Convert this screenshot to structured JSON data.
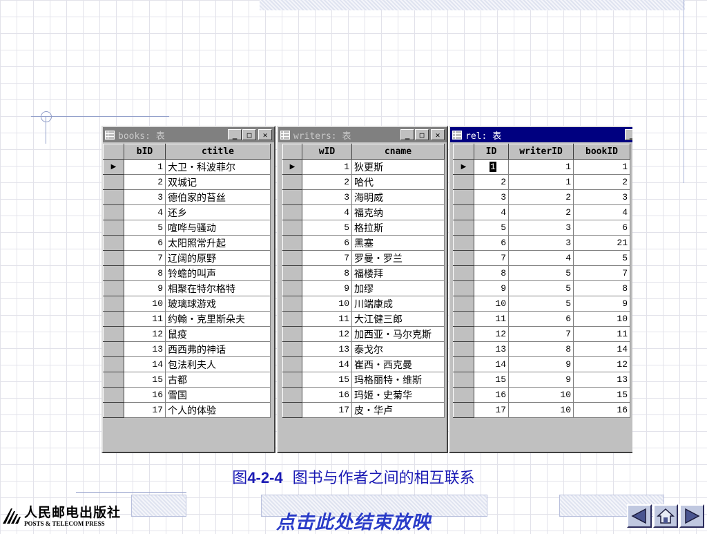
{
  "books_window": {
    "title": "books: 表",
    "columns": [
      "bID",
      "ctitle"
    ],
    "rows": [
      [
        "1",
        "大卫・科波菲尔"
      ],
      [
        "2",
        "双城记"
      ],
      [
        "3",
        "德伯家的苔丝"
      ],
      [
        "4",
        "还乡"
      ],
      [
        "5",
        "喧哗与骚动"
      ],
      [
        "6",
        "太阳照常升起"
      ],
      [
        "7",
        "辽阔的原野"
      ],
      [
        "8",
        "铃蟾的叫声"
      ],
      [
        "9",
        "相聚在特尔格特"
      ],
      [
        "10",
        "玻璃球游戏"
      ],
      [
        "11",
        "约翰・克里斯朵夫"
      ],
      [
        "12",
        "鼠疫"
      ],
      [
        "13",
        "西西弗的神话"
      ],
      [
        "14",
        "包法利夫人"
      ],
      [
        "15",
        "古都"
      ],
      [
        "16",
        "雪国"
      ],
      [
        "17",
        "个人的体验"
      ]
    ]
  },
  "writers_window": {
    "title": "writers: 表",
    "columns": [
      "wID",
      "cname"
    ],
    "rows": [
      [
        "1",
        "狄更斯"
      ],
      [
        "2",
        "哈代"
      ],
      [
        "3",
        "海明威"
      ],
      [
        "4",
        "福克纳"
      ],
      [
        "5",
        "格拉斯"
      ],
      [
        "6",
        "黑塞"
      ],
      [
        "7",
        "罗曼・罗兰"
      ],
      [
        "8",
        "福楼拜"
      ],
      [
        "9",
        "加缪"
      ],
      [
        "10",
        "川端康成"
      ],
      [
        "11",
        "大江健三郎"
      ],
      [
        "12",
        "加西亚・马尔克斯"
      ],
      [
        "13",
        "泰戈尔"
      ],
      [
        "14",
        "崔西・西克曼"
      ],
      [
        "15",
        "玛格丽特・维斯"
      ],
      [
        "16",
        "玛姬・史菊华"
      ],
      [
        "17",
        "皮・华卢"
      ]
    ]
  },
  "rel_window": {
    "title": "rel: 表",
    "columns": [
      "ID",
      "writerID",
      "bookID"
    ],
    "rows": [
      [
        "1",
        "1",
        "1"
      ],
      [
        "2",
        "1",
        "2"
      ],
      [
        "3",
        "2",
        "3"
      ],
      [
        "4",
        "2",
        "4"
      ],
      [
        "5",
        "3",
        "6"
      ],
      [
        "6",
        "3",
        "21"
      ],
      [
        "7",
        "4",
        "5"
      ],
      [
        "8",
        "5",
        "7"
      ],
      [
        "9",
        "5",
        "8"
      ],
      [
        "10",
        "5",
        "9"
      ],
      [
        "11",
        "6",
        "10"
      ],
      [
        "12",
        "7",
        "11"
      ],
      [
        "13",
        "8",
        "14"
      ],
      [
        "14",
        "9",
        "12"
      ],
      [
        "15",
        "9",
        "13"
      ],
      [
        "16",
        "10",
        "15"
      ],
      [
        "17",
        "10",
        "16"
      ]
    ]
  },
  "window_controls": {
    "minimize": "_",
    "maximize": "□",
    "close": "✕"
  },
  "caption": {
    "prefix": "图",
    "number": "4-2-4",
    "text": "图书与作者之间的相互联系"
  },
  "publisher": {
    "name_cn": "人民邮电出版社",
    "name_en": "POSTS & TELECOM PRESS"
  },
  "end_show_link": "点击此处结束放映",
  "nav": {
    "prev_icon": "prev-arrow-icon",
    "home_icon": "home-icon",
    "next_icon": "next-arrow-icon"
  }
}
